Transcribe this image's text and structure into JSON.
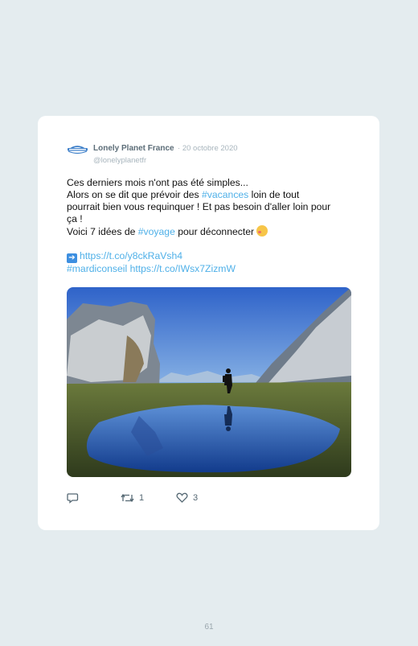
{
  "tweet": {
    "display_name": "Lonely Planet France",
    "date": "· 20 octobre 2020",
    "handle": "@lonelyplanetfr",
    "line1": "Ces derniers mois n'ont pas été simples...",
    "line2_before": "Alors on se dit que prévoir des ",
    "hashtag_vacances": "#vacances",
    "line2_after": " loin de tout pourrait bien vous requinquer ! Et pas besoin d'aller loin pour ça !",
    "line3_before": "Voici 7 idées de ",
    "hashtag_voyage": "#voyage",
    "line3_after": " pour déconnecter",
    "link1": "https://t.co/y8ckRaVsh4",
    "hashtag_mardiconseil": "#mardiconseil",
    "link2": "https://t.co/IWsx7ZizmW"
  },
  "actions": {
    "reply_count": "",
    "retweet_count": "1",
    "like_count": "3"
  },
  "footer": {
    "page_number": "61"
  },
  "colors": {
    "link": "#4fb0e8",
    "background": "#e4ecef",
    "card": "#ffffff"
  },
  "icons": [
    "lonely-planet-logo",
    "reply-icon",
    "retweet-icon",
    "heart-icon",
    "right-arrow-emoji",
    "smiling-face-with-hearts-emoji"
  ]
}
